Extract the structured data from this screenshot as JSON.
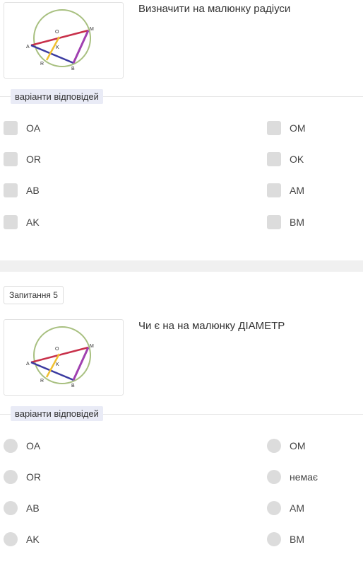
{
  "question_4": {
    "text": "Визначити на малюнку радіуси",
    "options_label": "варіанти відповідей",
    "options": [
      {
        "label": "OA",
        "col": "left"
      },
      {
        "label": "OM",
        "col": "right"
      },
      {
        "label": "OR",
        "col": "left"
      },
      {
        "label": "OK",
        "col": "right"
      },
      {
        "label": "AB",
        "col": "left"
      },
      {
        "label": "AM",
        "col": "right"
      },
      {
        "label": "AK",
        "col": "left"
      },
      {
        "label": "BM",
        "col": "right"
      }
    ],
    "input_type": "checkbox"
  },
  "question_5": {
    "badge": "Запитання 5",
    "text": "Чи є на на малюнку ДІАМЕТР",
    "options_label": "варіанти відповідей",
    "options": [
      {
        "label": "OA",
        "col": "left"
      },
      {
        "label": "OM",
        "col": "right"
      },
      {
        "label": "OR",
        "col": "left"
      },
      {
        "label": "немає",
        "col": "right"
      },
      {
        "label": "AB",
        "col": "left"
      },
      {
        "label": "AM",
        "col": "right"
      },
      {
        "label": "AK",
        "col": "left"
      },
      {
        "label": "BM",
        "col": "right"
      }
    ],
    "input_type": "radio"
  },
  "diagram_labels": {
    "o": "O",
    "m": "M",
    "a": "A",
    "k": "K",
    "r": "R",
    "b": "B"
  },
  "colors": {
    "circle": "#a8c080",
    "chord_am": "#c8304a",
    "segment_ab": "#3a3aa0",
    "segment_bm": "#a040b0",
    "segment_or": "#f0c030",
    "checkbox": "#dcdcdc",
    "tag_bg": "#e9ebf6"
  }
}
